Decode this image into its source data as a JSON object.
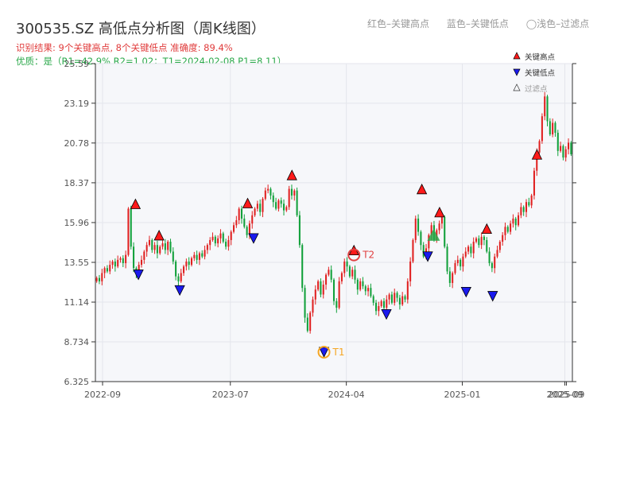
{
  "header": {
    "title": "300535.SZ 高低点分析图（周K线图）",
    "result_line": "识别结果: 9个关键高点, 8个关键低点  准确度: 89.4%",
    "quality_line": "优质：是（R1=42.9%  R2=1.02；T1=2024-02-08 P1=8.11）",
    "legend_red": "红色–关键高点",
    "legend_blue": "蓝色–关键低点",
    "legend_light": "◯浅色–过滤点"
  },
  "legend": {
    "high": "关键高点",
    "low": "关键低点",
    "filtered": "过滤点"
  },
  "colors": {
    "up": "#e02020",
    "down": "#11a03a",
    "high_marker": "#ff1a1a",
    "low_marker": "#1a1aee",
    "t1_ring": "#f5a623",
    "t2_ring": "#e04040",
    "filtered_marker": "#2aa84a",
    "plot_bg": "#f6f7fa",
    "grid": "#e4e6ec"
  },
  "chart_data": {
    "type": "candlestick",
    "ylim": [
      6.325,
      25.59
    ],
    "y_ticks": [
      "6.325",
      "8.734",
      "11.14",
      "13.55",
      "15.96",
      "18.37",
      "20.78",
      "23.19",
      "25.59"
    ],
    "x_ticks": [
      {
        "label": "2022-09",
        "x": "2022-09"
      },
      {
        "label": "2023-07",
        "x": "2023-07"
      },
      {
        "label": "2024-04",
        "x": "2024-04"
      },
      {
        "label": "2025-01",
        "x": "2025-01"
      },
      {
        "label": "2025-09",
        "x": "2025-09"
      },
      {
        "label": "2025-09",
        "x": "2025-09"
      }
    ],
    "closes": [
      12.6,
      12.4,
      12.9,
      13.2,
      13.0,
      13.4,
      13.6,
      13.3,
      13.7,
      13.8,
      13.5,
      14.0,
      16.8,
      14.5,
      13.2,
      12.9,
      13.4,
      13.7,
      14.2,
      14.6,
      14.9,
      14.3,
      14.6,
      14.1,
      14.5,
      14.7,
      14.3,
      14.8,
      14.2,
      13.6,
      12.7,
      12.4,
      12.9,
      13.3,
      13.6,
      13.4,
      13.8,
      14.0,
      13.7,
      14.1,
      13.9,
      14.3,
      14.6,
      14.9,
      15.1,
      14.7,
      15.0,
      15.3,
      14.8,
      14.5,
      14.9,
      15.4,
      15.8,
      16.1,
      16.8,
      16.2,
      15.7,
      15.2,
      15.9,
      16.4,
      16.8,
      17.1,
      16.6,
      17.4,
      17.9,
      18.0,
      17.6,
      17.2,
      16.8,
      17.3,
      17.1,
      16.7,
      16.9,
      18.0,
      17.6,
      17.9,
      16.4,
      14.6,
      12.0,
      10.2,
      9.4,
      10.5,
      11.3,
      11.9,
      12.4,
      11.6,
      12.2,
      12.8,
      13.1,
      12.5,
      11.2,
      10.8,
      12.4,
      12.9,
      13.6,
      13.3,
      12.7,
      13.1,
      12.5,
      11.9,
      12.4,
      12.1,
      11.8,
      12.0,
      11.5,
      11.1,
      10.6,
      10.9,
      11.2,
      10.8,
      11.3,
      11.6,
      11.1,
      11.7,
      11.4,
      11.0,
      11.5,
      11.3,
      12.4,
      13.6,
      14.9,
      16.2,
      15.4,
      14.6,
      13.9,
      14.4,
      15.2,
      15.8,
      14.9,
      15.5,
      15.9,
      16.3,
      14.5,
      13.0,
      12.3,
      12.9,
      13.5,
      13.7,
      13.3,
      13.9,
      14.2,
      14.5,
      14.1,
      14.8,
      15.0,
      14.6,
      15.1,
      14.9,
      14.2,
      13.5,
      13.2,
      13.9,
      14.3,
      14.8,
      15.2,
      15.7,
      15.4,
      15.9,
      16.2,
      15.8,
      16.4,
      16.9,
      16.6,
      17.2,
      17.0,
      17.6,
      19.1,
      20.2,
      20.9,
      22.4,
      23.6,
      22.1,
      21.3,
      22.0,
      21.4,
      20.3,
      20.6,
      19.9,
      20.4,
      20.8,
      20.1
    ],
    "highs": [
      {
        "date": "2022-11-18",
        "price": 16.8
      },
      {
        "date": "2023-01-13",
        "price": 14.9
      },
      {
        "date": "2023-08-11",
        "price": 16.85
      },
      {
        "date": "2023-11-24",
        "price": 18.55
      },
      {
        "date": "2024-04-19",
        "price": 14.0
      },
      {
        "date": "2024-09-27",
        "price": 17.7
      },
      {
        "date": "2024-11-08",
        "price": 16.3
      },
      {
        "date": "2025-02-28",
        "price": 15.3
      },
      {
        "date": "2025-06-27",
        "price": 19.8
      }
    ],
    "lows": [
      {
        "date": "2022-11-25",
        "price": 12.8
      },
      {
        "date": "2023-03-03",
        "price": 11.85
      },
      {
        "date": "2023-08-25",
        "price": 15.0
      },
      {
        "date": "2024-02-08",
        "price": 8.11
      },
      {
        "date": "2024-07-05",
        "price": 10.4
      },
      {
        "date": "2024-10-11",
        "price": 13.9
      },
      {
        "date": "2025-01-10",
        "price": 11.75
      },
      {
        "date": "2025-03-14",
        "price": 11.5
      }
    ],
    "filtered": [
      {
        "date": "2024-10-25",
        "price": 15.0
      }
    ],
    "annotations": [
      {
        "label": "T1",
        "date": "2024-02-08",
        "price": 8.11
      },
      {
        "label": "T2",
        "date": "2024-04-19",
        "price": 14.0
      }
    ],
    "legend_position": "top-right",
    "grid": true
  }
}
